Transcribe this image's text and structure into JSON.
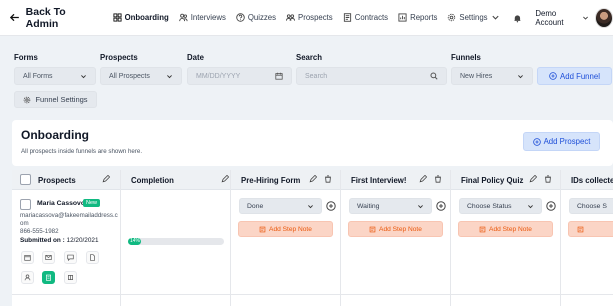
{
  "topbar": {
    "back_label": "Back To Admin",
    "nav": [
      {
        "label": "Onboarding",
        "icon": "grid-icon",
        "active": true
      },
      {
        "label": "Interviews",
        "icon": "users-icon"
      },
      {
        "label": "Quizzes",
        "icon": "question-icon"
      },
      {
        "label": "Prospects",
        "icon": "prospects-icon"
      },
      {
        "label": "Contracts",
        "icon": "contract-icon"
      },
      {
        "label": "Reports",
        "icon": "report-icon"
      },
      {
        "label": "Settings",
        "icon": "gear-icon"
      }
    ],
    "account_label": "Demo Account"
  },
  "filters": {
    "forms_label": "Forms",
    "forms_value": "All Forms",
    "prospects_label": "Prospects",
    "prospects_value": "All Prospects",
    "date_label": "Date",
    "date_placeholder": "MM/DD/YYYY",
    "search_label": "Search",
    "search_placeholder": "Search",
    "funnels_label": "Funnels",
    "funnels_value": "New Hires",
    "add_funnel_label": "Add Funnel",
    "funnel_settings_label": "Funnel Settings"
  },
  "header_card": {
    "title": "Onboarding",
    "subtitle": "All prospects inside funnels are shown here.",
    "add_prospect_label": "Add Prospect"
  },
  "board": {
    "columns": {
      "prospects": "Prospects",
      "completion": "Completion",
      "prehiring": "Pre-Hiring Form",
      "interview": "First Interview!",
      "quiz": "Final Policy Quiz",
      "ids": "IDs collecte"
    },
    "row": {
      "name": "Maria Cassovo",
      "badge": "New",
      "email": "mariacassova@fakeemailaddress.com",
      "phone": "866-555-1982",
      "submitted_label": "Submitted on :",
      "submitted_date": "12/20/2021",
      "completion_pct": 14,
      "completion_text": "14%",
      "prehiring_status": "Done",
      "interview_status": "Waiting",
      "quiz_status": "Choose Status",
      "ids_status": "Choose S",
      "add_step_note": "Add Step Note"
    }
  },
  "colors": {
    "accent": "#1d4ed8",
    "accent_bg": "#d6e4fb",
    "success": "#10b981",
    "note_bg": "#fbd5c6",
    "note_text": "#ea580c"
  }
}
